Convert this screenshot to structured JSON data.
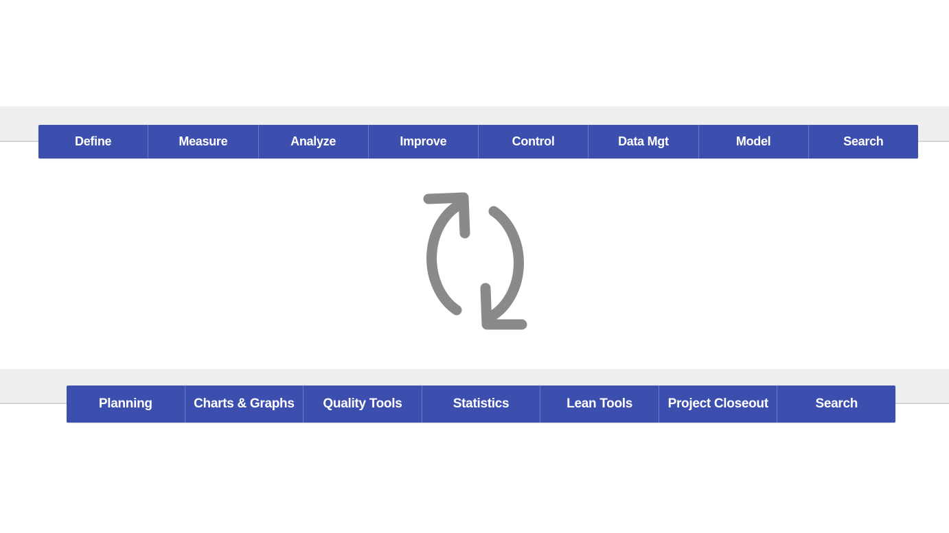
{
  "top_menu": {
    "tabs": [
      {
        "label": "Define"
      },
      {
        "label": "Measure"
      },
      {
        "label": "Analyze"
      },
      {
        "label": "Improve"
      },
      {
        "label": "Control"
      },
      {
        "label": "Data Mgt"
      },
      {
        "label": "Model"
      },
      {
        "label": "Search"
      }
    ]
  },
  "center": {
    "icon": "refresh-icon"
  },
  "bottom_menu": {
    "tabs": [
      {
        "label": "Planning"
      },
      {
        "label": "Charts & Graphs"
      },
      {
        "label": "Quality Tools"
      },
      {
        "label": "Statistics"
      },
      {
        "label": "Lean Tools"
      },
      {
        "label": "Project Closeout"
      },
      {
        "label": "Search"
      }
    ]
  },
  "colors": {
    "tab_background": "#3d4fae",
    "tab_divider": "#6b79c2",
    "tab_text": "#ffffff",
    "band_background": "#efefef",
    "icon_gray": "#8a8a8a"
  }
}
